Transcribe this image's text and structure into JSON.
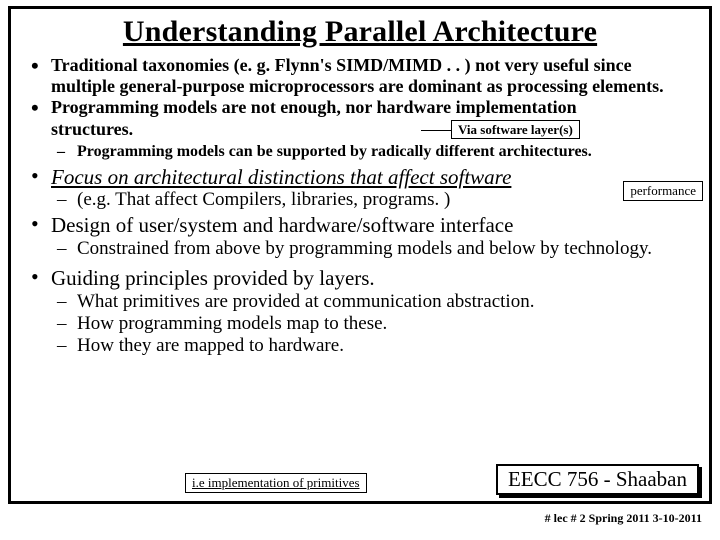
{
  "title": "Understanding Parallel Architecture",
  "bullets": {
    "b1": "Traditional taxonomies (e. g. Flynn's SIMD/MIMD . . ) not very useful since multiple general-purpose microprocessors are dominant as processing elements.",
    "b2a": "Programming models are not enough, nor hardware implementation",
    "b2b": "structures.",
    "box_soft": "Via software layer(s)",
    "sub1": "Programming models can be supported by radically different architectures.",
    "b3": "Focus on architectural distinctions that affect software",
    "box_perf": "performance",
    "sub3": "(e.g.  That affect Compilers, libraries, programs. )",
    "b4": "Design of user/system and hardware/software interface",
    "sub4": "Constrained from above by programming models and below by technology.",
    "b5": "Guiding principles provided by layers.",
    "sub5a": "What primitives are provided at communication abstraction.",
    "sub5b": "How programming models map to these.",
    "sub5c": "How they are mapped to hardware.",
    "box_impl": "i.e implementation of primitives"
  },
  "course": "EECC 756 - Shaaban",
  "footer": "#   lec # 2     Spring 2011   3-10-2011"
}
